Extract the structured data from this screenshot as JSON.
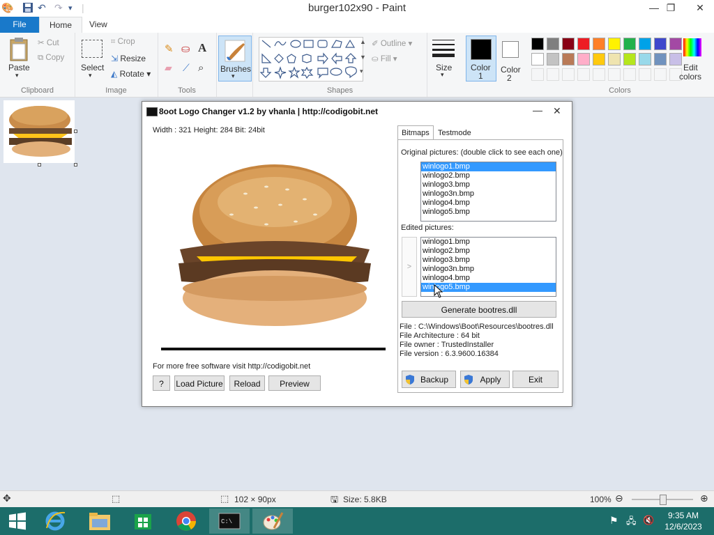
{
  "window": {
    "title": "burger102x90 - Paint"
  },
  "tabs": {
    "file": "File",
    "home": "Home",
    "view": "View"
  },
  "ribbon": {
    "clipboard": {
      "paste": "Paste",
      "cut": "Cut",
      "copy": "Copy",
      "label": "Clipboard"
    },
    "image": {
      "select": "Select",
      "crop": "Crop",
      "resize": "Resize",
      "rotate": "Rotate",
      "label": "Image"
    },
    "tools": {
      "label": "Tools"
    },
    "brushes": {
      "label": "Brushes"
    },
    "shapes": {
      "outline": "Outline",
      "fill": "Fill",
      "label": "Shapes"
    },
    "size": {
      "label": "Size"
    },
    "color1": {
      "label": "Color",
      "num": "1"
    },
    "color2": {
      "label": "Color",
      "num": "2"
    },
    "colors": {
      "label": "Colors",
      "edit_line1": "Edit",
      "edit_line2": "colors",
      "palette_row1": [
        "#000000",
        "#7f7f7f",
        "#880015",
        "#ed1c24",
        "#ff7f27",
        "#fff200",
        "#22b14c",
        "#00a2e8",
        "#3f48cc",
        "#a349a4"
      ],
      "palette_row2": [
        "#ffffff",
        "#c3c3c3",
        "#b97a57",
        "#ffaec9",
        "#ffc90e",
        "#efe4b0",
        "#b5e61d",
        "#99d9ea",
        "#7092be",
        "#c8bfe7"
      ]
    }
  },
  "dialog": {
    "title": "8oot Logo Changer v1.2 by vhanla | http://codigobit.net",
    "info": "Width : 321 Height: 284 Bit: 24bit",
    "footer_text": "For more free software visit  http://codigobit.net",
    "buttons": {
      "help": "?",
      "load": "Load Picture",
      "reload": "Reload",
      "preview": "Preview"
    },
    "tabs": {
      "bitmaps": "Bitmaps",
      "testmode": "Testmode"
    },
    "original_label": "Original pictures: (double click to see each one)",
    "original_items": [
      "winlogo1.bmp",
      "winlogo2.bmp",
      "winlogo3.bmp",
      "winlogo3n.bmp",
      "winlogo4.bmp",
      "winlogo5.bmp"
    ],
    "edited_label": "Edited pictures:",
    "edited_items": [
      "winlogo1.bmp",
      "winlogo2.bmp",
      "winlogo3.bmp",
      "winlogo3n.bmp",
      "winlogo4.bmp",
      "winlogo5.bmp"
    ],
    "arrow": ">",
    "generate": "Generate bootres.dll",
    "file_info": {
      "file": "File : C:\\Windows\\Boot\\Resources\\bootres.dll",
      "arch": "File Architecture : 64 bit",
      "owner": "File owner : TrustedInstaller",
      "version": "File version : 6.3.9600.16384"
    },
    "backup": "Backup",
    "apply": "Apply",
    "exit": "Exit"
  },
  "status": {
    "dimensions": "102 × 90px",
    "size": "Size: 5.8KB",
    "zoom": "100%"
  },
  "tray": {
    "time": "9:35 AM",
    "date": "12/6/2023"
  }
}
